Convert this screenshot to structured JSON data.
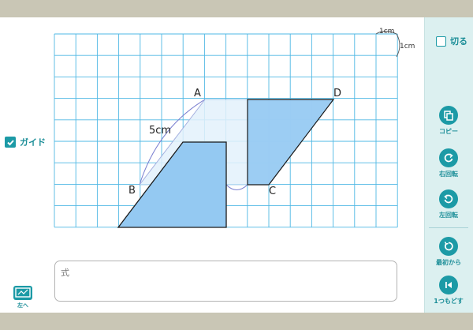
{
  "canvas": {
    "points": {
      "a": "A",
      "b": "B",
      "c": "C",
      "d": "D"
    },
    "length_label": "5cm",
    "scale_label_top": "1cm",
    "scale_label_side": "1cm"
  },
  "guide": {
    "label": "ガイド",
    "checked": true
  },
  "formula": {
    "label": "式",
    "value": ""
  },
  "nav": {
    "prev_label": "左へ"
  },
  "cut": {
    "label": "切る",
    "checked": false
  },
  "tools": {
    "copy": "コピー",
    "rotate_right": "右回転",
    "rotate_left": "左回転",
    "reset": "最初から",
    "undo": "1つもどす"
  },
  "colors": {
    "grid_line": "#4fb8e4",
    "shape_fill": "#94c9f2",
    "teal": "#1c9aa6",
    "panel_bg": "#dcf0f0"
  }
}
